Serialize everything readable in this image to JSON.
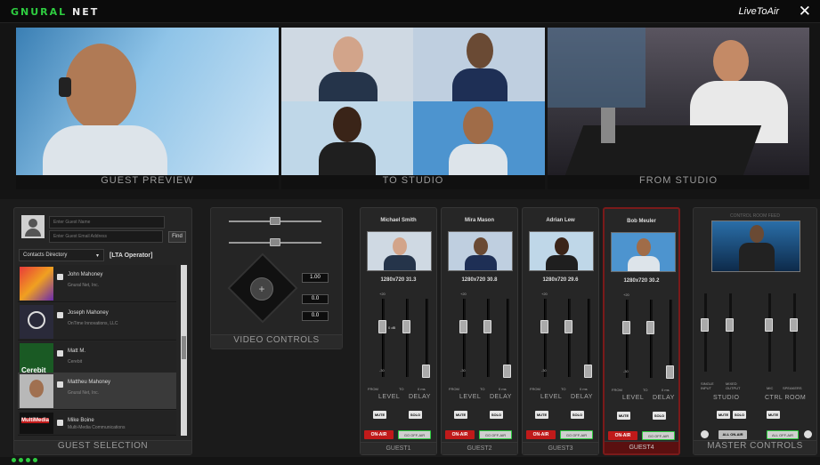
{
  "app": {
    "logo_left": "GNURAL",
    "logo_right": "NET",
    "title": "LiveToAir",
    "close_icon": "close-icon"
  },
  "video": {
    "guest_preview": "GUEST PREVIEW",
    "to_studio": "TO STUDIO",
    "from_studio": "FROM STUDIO"
  },
  "guest_selection": {
    "name_placeholder": "Enter Guest Name",
    "email_placeholder": "Enter Guest Email Address",
    "find_label": "Find",
    "directory": "Contacts Directory",
    "operator": "[LTA Operator]",
    "contacts": [
      {
        "name": "John Mahoney",
        "org": "Gnural Net, Inc."
      },
      {
        "name": "Joseph Mahoney",
        "org": "OnTime Innovations, LLC"
      },
      {
        "name": "Matt M.",
        "org": "Cerebit"
      },
      {
        "name": "Mattheu Mahoney",
        "org": "Gnural Net, Inc."
      },
      {
        "name": "Mike Boine",
        "org": "Multi-Media Communications"
      }
    ],
    "footer": "GUEST SELECTION"
  },
  "video_controls": {
    "zoom": "1.00",
    "pan": "0.0",
    "tilt": "0.0",
    "footer": "VIDEO CONTROLS"
  },
  "guests": [
    {
      "name": "Michael Smith",
      "res": "1280x720 31.3",
      "footer": "GUEST1"
    },
    {
      "name": "Mira Mason",
      "res": "1280x720 30.8",
      "footer": "GUEST2"
    },
    {
      "name": "Adrian Lew",
      "res": "1280x720 29.6",
      "footer": "GUEST3"
    },
    {
      "name": "Bob Meuler",
      "res": "1280x720 30.2",
      "footer": "GUEST4"
    }
  ],
  "strip": {
    "from": "FROM",
    "to": "TO",
    "ms": "0 ms",
    "level": "LEVEL",
    "delay": "DELAY",
    "mute": "MUTE",
    "solo": "SOLO",
    "on_air": "ON-AIR",
    "go_off_air": "GO OFF-AIR",
    "db_top": "+20",
    "db_0": "0 dB",
    "db_bottom": "-30"
  },
  "master": {
    "feed": "CONTROL ROOM FEED",
    "single_input": "SINGLE INPUT",
    "mixed_output": "MIXED OUTPUT",
    "mic": "MIC",
    "speakers": "SPEAKERS",
    "studio": "STUDIO",
    "ctrl_room": "CTRL ROOM",
    "all_on_air": "ALL ON-AIR",
    "all_off_air": "ALL OFF-AIR",
    "footer": "MASTER CONTROLS"
  }
}
